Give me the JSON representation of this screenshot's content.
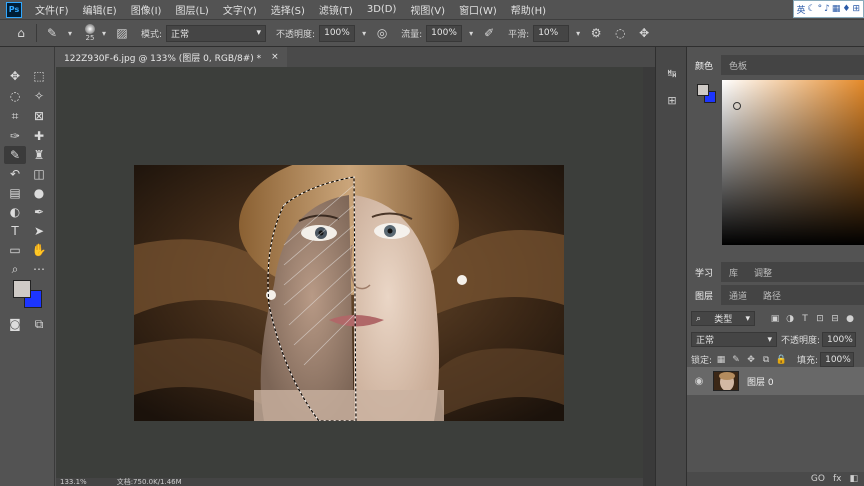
{
  "menubar": {
    "logo": "Ps",
    "items": [
      "文件(F)",
      "编辑(E)",
      "图像(I)",
      "图层(L)",
      "文字(Y)",
      "选择(S)",
      "滤镜(T)",
      "3D(D)",
      "视图(V)",
      "窗口(W)",
      "帮助(H)"
    ],
    "ime_label": "英"
  },
  "options": {
    "brush_size": "25",
    "mode_label": "模式:",
    "mode_value": "正常",
    "opacity_label": "不透明度:",
    "opacity_value": "100%",
    "flow_label": "流量:",
    "flow_value": "100%",
    "smoothing_label": "平滑:",
    "smoothing_value": "10%"
  },
  "document": {
    "tab_title": "122Z930F-6.jpg @ 133% (图层 0, RGB/8#) *",
    "tab_close": "×",
    "zoom": "133.1%",
    "doc_info": "文档:750.0K/1.46M"
  },
  "panels": {
    "color_tabs": [
      "颜色",
      "色板"
    ],
    "learn_tabs": [
      "学习",
      "库",
      "调整"
    ],
    "layer_tabs": [
      "图层",
      "通道",
      "路径"
    ],
    "filter_kind": "类型",
    "blend_mode": "正常",
    "opacity_label": "不透明度:",
    "opacity_value": "100%",
    "lock_label": "锁定:",
    "fill_label": "填充:",
    "fill_value": "100%",
    "layer_name": "图层 0",
    "footer_icons": [
      "GO",
      "fx"
    ]
  },
  "colors": {
    "foreground": "#cfcac6",
    "background": "#1c35ff",
    "accent": "#31a8ff"
  }
}
